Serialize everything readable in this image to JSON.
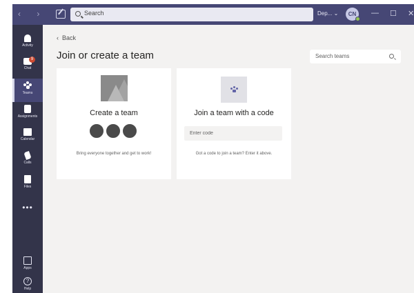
{
  "titlebar": {
    "search_label": "Search",
    "tenant_label": "Dep... ⌄",
    "avatar_initials": "CN",
    "minimize": "—",
    "maximize": "☐",
    "close": "✕",
    "accent_color": "#464775"
  },
  "rail": {
    "items": [
      {
        "label": "Activity",
        "icon": "bell-icon"
      },
      {
        "label": "Chat",
        "icon": "chat-icon",
        "badge": "9"
      },
      {
        "label": "Teams",
        "icon": "teams-icon",
        "active": true
      },
      {
        "label": "Assignments",
        "icon": "assignments-icon"
      },
      {
        "label": "Calendar",
        "icon": "calendar-icon"
      },
      {
        "label": "Calls",
        "icon": "phone-icon"
      },
      {
        "label": "Files",
        "icon": "files-icon"
      }
    ],
    "more_label": "•••",
    "apps_label": "Apps",
    "help_label": "Help",
    "help_glyph": "?"
  },
  "main": {
    "back_label": "Back",
    "page_title": "Join or create a team",
    "search_teams_placeholder": "Search teams"
  },
  "create_card": {
    "title": "Create a team",
    "description": "Bring everyone together and get to work!"
  },
  "join_card": {
    "title": "Join a team with a code",
    "code_placeholder": "Enter code",
    "description": "Got a code to join a team? Enter it above."
  }
}
